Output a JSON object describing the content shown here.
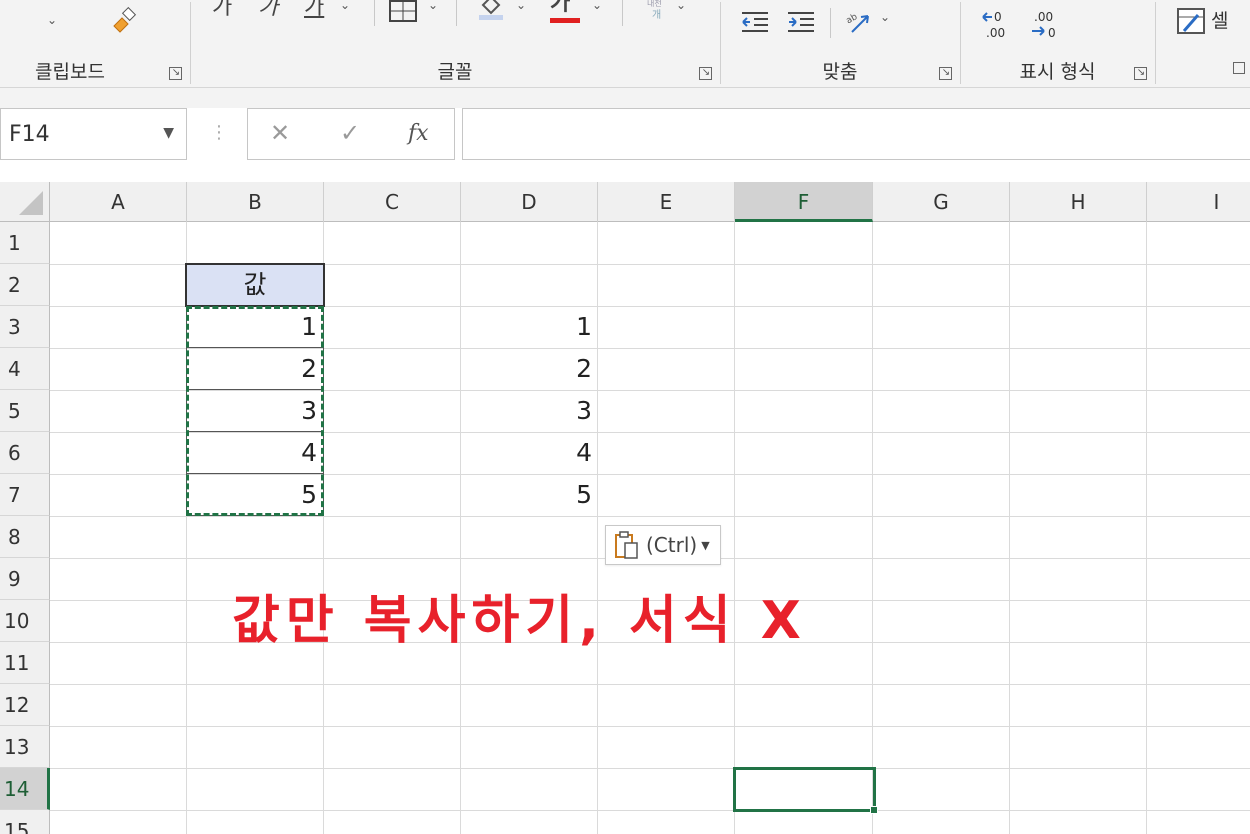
{
  "ribbon": {
    "groups": {
      "clipboard": "클립보드",
      "font": "글꼴",
      "alignment": "맞춤",
      "number": "표시 형식"
    },
    "font_buttons": {
      "big": "가",
      "small": "가",
      "underline": "가",
      "fontcolor": "가"
    },
    "number_buttons": {
      "increase": ".00",
      "decrease": ".00"
    },
    "cells_label": "셀"
  },
  "formula_bar": {
    "name_box": "F14",
    "cancel_symbol": "✕",
    "enter_symbol": "✓",
    "fx_symbol": "fx",
    "formula": ""
  },
  "columns": [
    "A",
    "B",
    "C",
    "D",
    "E",
    "F",
    "G",
    "H",
    "I"
  ],
  "selected_column": "F",
  "rows": [
    "1",
    "2",
    "3",
    "4",
    "5",
    "6",
    "7",
    "8",
    "9",
    "10",
    "11",
    "12",
    "13",
    "14",
    "15"
  ],
  "selected_row": "14",
  "cells": {
    "B2": "값",
    "B3": "1",
    "B4": "2",
    "B5": "3",
    "B6": "4",
    "B7": "5",
    "D3": "1",
    "D4": "2",
    "D5": "3",
    "D6": "4",
    "D7": "5"
  },
  "paste_options": {
    "label": "(Ctrl)"
  },
  "annotation": "값만 복사하기, 서식 X",
  "colors": {
    "accent_green": "#217346",
    "header_fill": "#dae1f4",
    "annotation_red": "#e8212b"
  }
}
